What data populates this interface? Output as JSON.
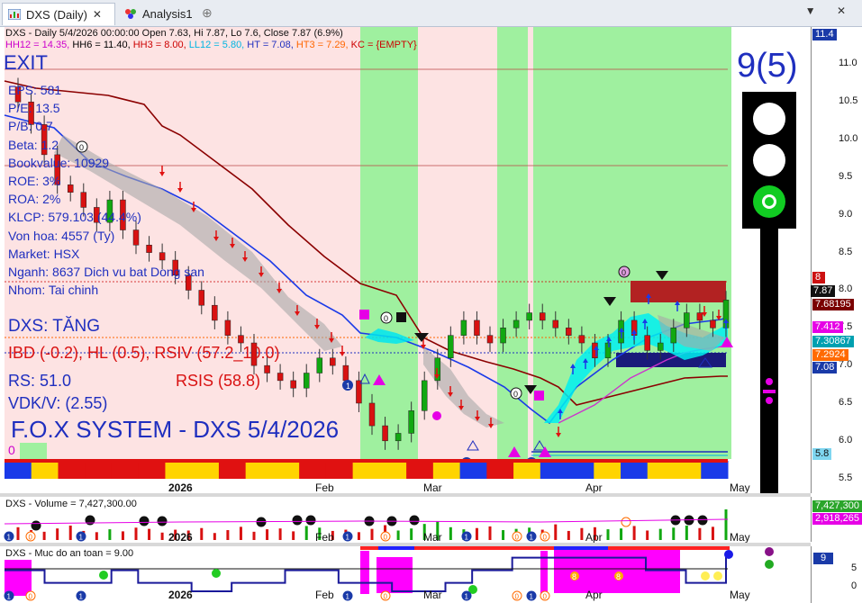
{
  "tabs": [
    {
      "label": "DXS (Daily)",
      "active": true
    },
    {
      "label": "Analysis1",
      "active": false
    }
  ],
  "window_buttons": "▼ ✕",
  "price_pane": {
    "header_line1": "DXS - Daily 5/4/2026 00:00:00 Open 7.63, Hi 7.87, Lo 7.6, Close 7.87 (6.9%)",
    "header_line2": [
      {
        "text": "HH12 = 14.35, ",
        "color": "#cc00cc"
      },
      {
        "text": "HH6 = 11.40, ",
        "color": "#000000"
      },
      {
        "text": "HH3 = 8.00, ",
        "color": "#cc0000"
      },
      {
        "text": "LL12 = 5.80, ",
        "color": "#00b5e2"
      },
      {
        "text": "HT = 7.08, ",
        "color": "#1f2fbf"
      },
      {
        "text": "HT3 = 7.29, ",
        "color": "#ff6600"
      },
      {
        "text": "KC = {EMPTY}",
        "color": "#cc0000"
      }
    ],
    "exit_label": "EXIT",
    "fundamentals": [
      "EPS: 581",
      "P/E: 13.5",
      "P/B: 0.7",
      "Beta: 1.2",
      "Bookvalue: 10929",
      "ROE: 3%",
      "ROA: 2%",
      "KLCP: 579.103 (44.4%)",
      "Von hoa: 4557 (Ty)",
      "Market: HSX",
      "Nganh: 8637 Dich vu bat Dong san",
      "Nhom: Tai chinh"
    ],
    "trend_label": "DXS: TĂNG",
    "ibd_label": "IBD (-0.2), HL (0.5), RSIV (57.2_10.0)",
    "rs_label": "RS: 51.0",
    "rsis_label": "RSIS (58.8)",
    "vdk_label": "VDK/V:  (2.55)",
    "system_label": "F.O.X SYSTEM - DXS 5/4/2026",
    "zero_label": "0",
    "signal_count": "9(5)",
    "y_ticks": [
      "11.0",
      "10.5",
      "10.0",
      "9.5",
      "9.0",
      "8.5",
      "8.0",
      "7.5",
      "7.0",
      "6.5",
      "6.0",
      "5.5"
    ],
    "tags": [
      {
        "text": "11.4",
        "bg": "#1a3aa8"
      },
      {
        "text": "8",
        "bg": "#cc1111"
      },
      {
        "text": "7.87",
        "bg": "#111111"
      },
      {
        "text": "7.68195",
        "bg": "#7a0000"
      },
      {
        "text": "7.412",
        "bg": "#e600e6"
      },
      {
        "text": "7.30867",
        "bg": "#00a0b0"
      },
      {
        "text": "7.2924",
        "bg": "#ff6a00"
      },
      {
        "text": "7.08",
        "bg": "#1a3aa8"
      },
      {
        "text": "5.8",
        "bg": "#7fd6f0"
      }
    ],
    "chart_data": {
      "type": "candlestick",
      "x_labels": [
        "2026",
        "Feb",
        "Mar",
        "Apr",
        "May"
      ],
      "ylim": [
        5.4,
        11.4
      ],
      "close": [
        10.5,
        10.2,
        9.8,
        9.4,
        9.3,
        9.1,
        8.9,
        9.2,
        8.8,
        8.6,
        8.5,
        8.4,
        8.2,
        8.0,
        7.8,
        7.6,
        7.4,
        7.3,
        7.0,
        6.9,
        6.8,
        6.7,
        6.9,
        7.1,
        7.0,
        6.8,
        6.5,
        6.2,
        6.0,
        6.1,
        6.4,
        6.8,
        7.1,
        7.4,
        7.6,
        7.4,
        7.3,
        7.5,
        7.6,
        7.7,
        7.6,
        7.5,
        7.4,
        7.3,
        7.1,
        7.3,
        7.6,
        7.4,
        7.2,
        7.3,
        7.5,
        7.7,
        7.6,
        7.5,
        7.87
      ]
    }
  },
  "volume_pane": {
    "title": "DXS - Volume = 7,427,300.00",
    "tags": [
      {
        "text": "7,427,300",
        "bg": "#2aa52a"
      },
      {
        "text": "2,918,265",
        "bg": "#e600e6"
      }
    ],
    "chart_data": {
      "type": "bar",
      "values": [
        3.1,
        2.4,
        2.0,
        2.8,
        3.5,
        2.2,
        1.9,
        2.6,
        2.1,
        3.0,
        2.7,
        1.8,
        2.5,
        2.3,
        2.9,
        1.7,
        2.4,
        3.2,
        2.0,
        2.6,
        2.8,
        2.1,
        3.4,
        3.0,
        2.2,
        2.5,
        1.9,
        2.7,
        3.6,
        2.3,
        2.8,
        3.9,
        4.5,
        3.1,
        2.6,
        2.9,
        3.3,
        2.4,
        2.7,
        3.0,
        2.5,
        3.8,
        2.2,
        2.9,
        3.1,
        2.6,
        2.8,
        3.4,
        2.3,
        2.7,
        3.0,
        3.5,
        2.9,
        3.2,
        7.43
      ]
    }
  },
  "safety_pane": {
    "title": "DXS - Muc do an toan = 9.00",
    "tags": [
      {
        "text": "9",
        "bg": "#1a3aa8"
      }
    ],
    "y_ticks": [
      "5",
      "0"
    ],
    "chart_data": {
      "type": "step",
      "values": [
        5,
        5,
        5,
        2,
        2,
        2,
        2,
        2,
        5,
        5,
        2,
        2,
        2,
        2,
        0,
        0,
        0,
        2,
        2,
        2,
        2,
        5,
        5,
        5,
        5,
        2,
        2,
        2,
        2,
        0,
        0,
        0,
        0,
        2,
        2,
        5,
        5,
        5,
        8,
        8,
        8,
        8,
        8,
        8,
        8,
        8,
        8,
        8,
        5,
        5,
        5,
        2,
        2,
        2,
        9
      ]
    }
  },
  "x_axis": [
    "2026",
    "Feb",
    "Mar",
    "Apr",
    "May"
  ]
}
